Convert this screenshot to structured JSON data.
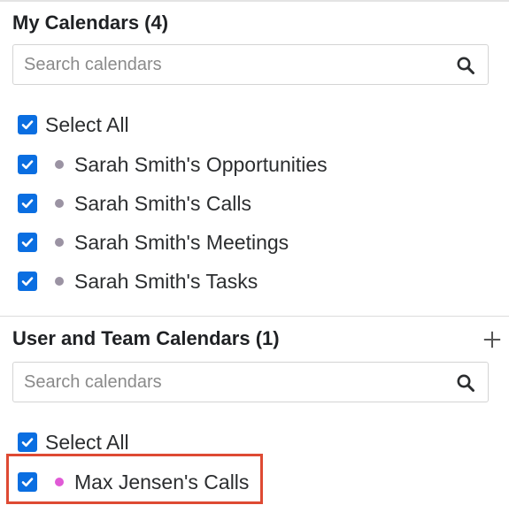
{
  "my_calendars": {
    "title": "My Calendars (4)",
    "search_placeholder": "Search calendars",
    "select_all_label": "Select All",
    "items": [
      {
        "label": "Sarah Smith's Opportunities",
        "dot_color": "#9b93a3",
        "checked": true
      },
      {
        "label": "Sarah Smith's Calls",
        "dot_color": "#9b93a3",
        "checked": true
      },
      {
        "label": "Sarah Smith's Meetings",
        "dot_color": "#9b93a3",
        "checked": true
      },
      {
        "label": "Sarah Smith's Tasks",
        "dot_color": "#9b93a3",
        "checked": true
      }
    ]
  },
  "team_calendars": {
    "title": "User and Team Calendars (1)",
    "search_placeholder": "Search calendars",
    "select_all_label": "Select All",
    "add_icon": "plus-icon",
    "items": [
      {
        "label": "Max Jensen's Calls",
        "dot_color": "#e05ad6",
        "checked": true
      }
    ]
  },
  "icons": {
    "search": "search-icon",
    "checkbox": "checkmark-icon",
    "add": "plus-icon"
  },
  "colors": {
    "checkbox": "#0a6ee1",
    "highlight": "#de4a33"
  }
}
